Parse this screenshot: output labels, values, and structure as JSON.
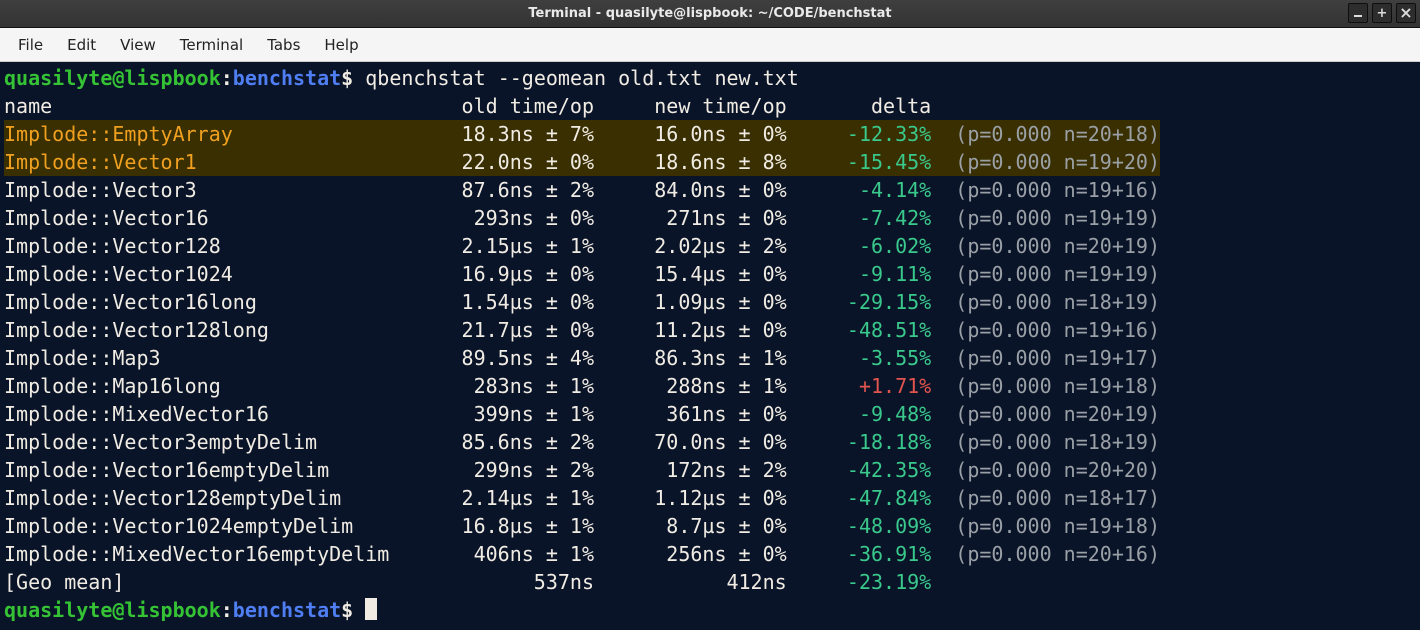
{
  "window": {
    "title": "Terminal - quasilyte@lispbook: ~/CODE/benchstat"
  },
  "menu": {
    "file": "File",
    "edit": "Edit",
    "view": "View",
    "terminal": "Terminal",
    "tabs": "Tabs",
    "help": "Help"
  },
  "prompt": {
    "user": "quasilyte",
    "at": "@",
    "host": "lispbook",
    "colon": ":",
    "dir": "benchstat",
    "dollar": "$"
  },
  "command": "qbenchstat --geomean old.txt new.txt",
  "header": {
    "name": "name",
    "old": "old time/op",
    "new": "new time/op",
    "delta": "delta"
  },
  "rows": [
    {
      "name": "Implode::EmptyArray",
      "old": "18.3ns ± 7%",
      "new": "16.0ns ± 0%",
      "delta": "-12.33%",
      "dtype": "neg",
      "pn": "(p=0.000 n=20+18)",
      "hl": true
    },
    {
      "name": "Implode::Vector1",
      "old": "22.0ns ± 0%",
      "new": "18.6ns ± 8%",
      "delta": "-15.45%",
      "dtype": "neg",
      "pn": "(p=0.000 n=19+20)",
      "hl": true
    },
    {
      "name": "Implode::Vector3",
      "old": "87.6ns ± 2%",
      "new": "84.0ns ± 0%",
      "delta": "-4.14%",
      "dtype": "neg",
      "pn": "(p=0.000 n=19+16)",
      "hl": false
    },
    {
      "name": "Implode::Vector16",
      "old": "293ns ± 0%",
      "new": "271ns ± 0%",
      "delta": "-7.42%",
      "dtype": "neg",
      "pn": "(p=0.000 n=19+19)",
      "hl": false
    },
    {
      "name": "Implode::Vector128",
      "old": "2.15µs ± 1%",
      "new": "2.02µs ± 2%",
      "delta": "-6.02%",
      "dtype": "neg",
      "pn": "(p=0.000 n=20+19)",
      "hl": false
    },
    {
      "name": "Implode::Vector1024",
      "old": "16.9µs ± 0%",
      "new": "15.4µs ± 0%",
      "delta": "-9.11%",
      "dtype": "neg",
      "pn": "(p=0.000 n=19+19)",
      "hl": false
    },
    {
      "name": "Implode::Vector16long",
      "old": "1.54µs ± 0%",
      "new": "1.09µs ± 0%",
      "delta": "-29.15%",
      "dtype": "neg",
      "pn": "(p=0.000 n=18+19)",
      "hl": false
    },
    {
      "name": "Implode::Vector128long",
      "old": "21.7µs ± 0%",
      "new": "11.2µs ± 0%",
      "delta": "-48.51%",
      "dtype": "neg",
      "pn": "(p=0.000 n=19+16)",
      "hl": false
    },
    {
      "name": "Implode::Map3",
      "old": "89.5ns ± 4%",
      "new": "86.3ns ± 1%",
      "delta": "-3.55%",
      "dtype": "neg",
      "pn": "(p=0.000 n=19+17)",
      "hl": false
    },
    {
      "name": "Implode::Map16long",
      "old": "283ns ± 1%",
      "new": "288ns ± 1%",
      "delta": "+1.71%",
      "dtype": "pos",
      "pn": "(p=0.000 n=19+18)",
      "hl": false
    },
    {
      "name": "Implode::MixedVector16",
      "old": "399ns ± 1%",
      "new": "361ns ± 0%",
      "delta": "-9.48%",
      "dtype": "neg",
      "pn": "(p=0.000 n=20+19)",
      "hl": false
    },
    {
      "name": "Implode::Vector3emptyDelim",
      "old": "85.6ns ± 2%",
      "new": "70.0ns ± 0%",
      "delta": "-18.18%",
      "dtype": "neg",
      "pn": "(p=0.000 n=18+19)",
      "hl": false
    },
    {
      "name": "Implode::Vector16emptyDelim",
      "old": "299ns ± 2%",
      "new": "172ns ± 2%",
      "delta": "-42.35%",
      "dtype": "neg",
      "pn": "(p=0.000 n=20+20)",
      "hl": false
    },
    {
      "name": "Implode::Vector128emptyDelim",
      "old": "2.14µs ± 1%",
      "new": "1.12µs ± 0%",
      "delta": "-47.84%",
      "dtype": "neg",
      "pn": "(p=0.000 n=18+17)",
      "hl": false
    },
    {
      "name": "Implode::Vector1024emptyDelim",
      "old": "16.8µs ± 1%",
      "new": "8.7µs ± 0%",
      "delta": "-48.09%",
      "dtype": "neg",
      "pn": "(p=0.000 n=19+18)",
      "hl": false
    },
    {
      "name": "Implode::MixedVector16emptyDelim",
      "old": "406ns ± 1%",
      "new": "256ns ± 0%",
      "delta": "-36.91%",
      "dtype": "neg",
      "pn": "(p=0.000 n=20+16)",
      "hl": false
    }
  ],
  "geomean": {
    "name": "[Geo mean]",
    "old": "537ns",
    "new": "412ns",
    "delta": "-23.19%",
    "dtype": "neg"
  },
  "colwidths": {
    "name": 35,
    "old": 14,
    "new": 14,
    "delta": 10
  }
}
